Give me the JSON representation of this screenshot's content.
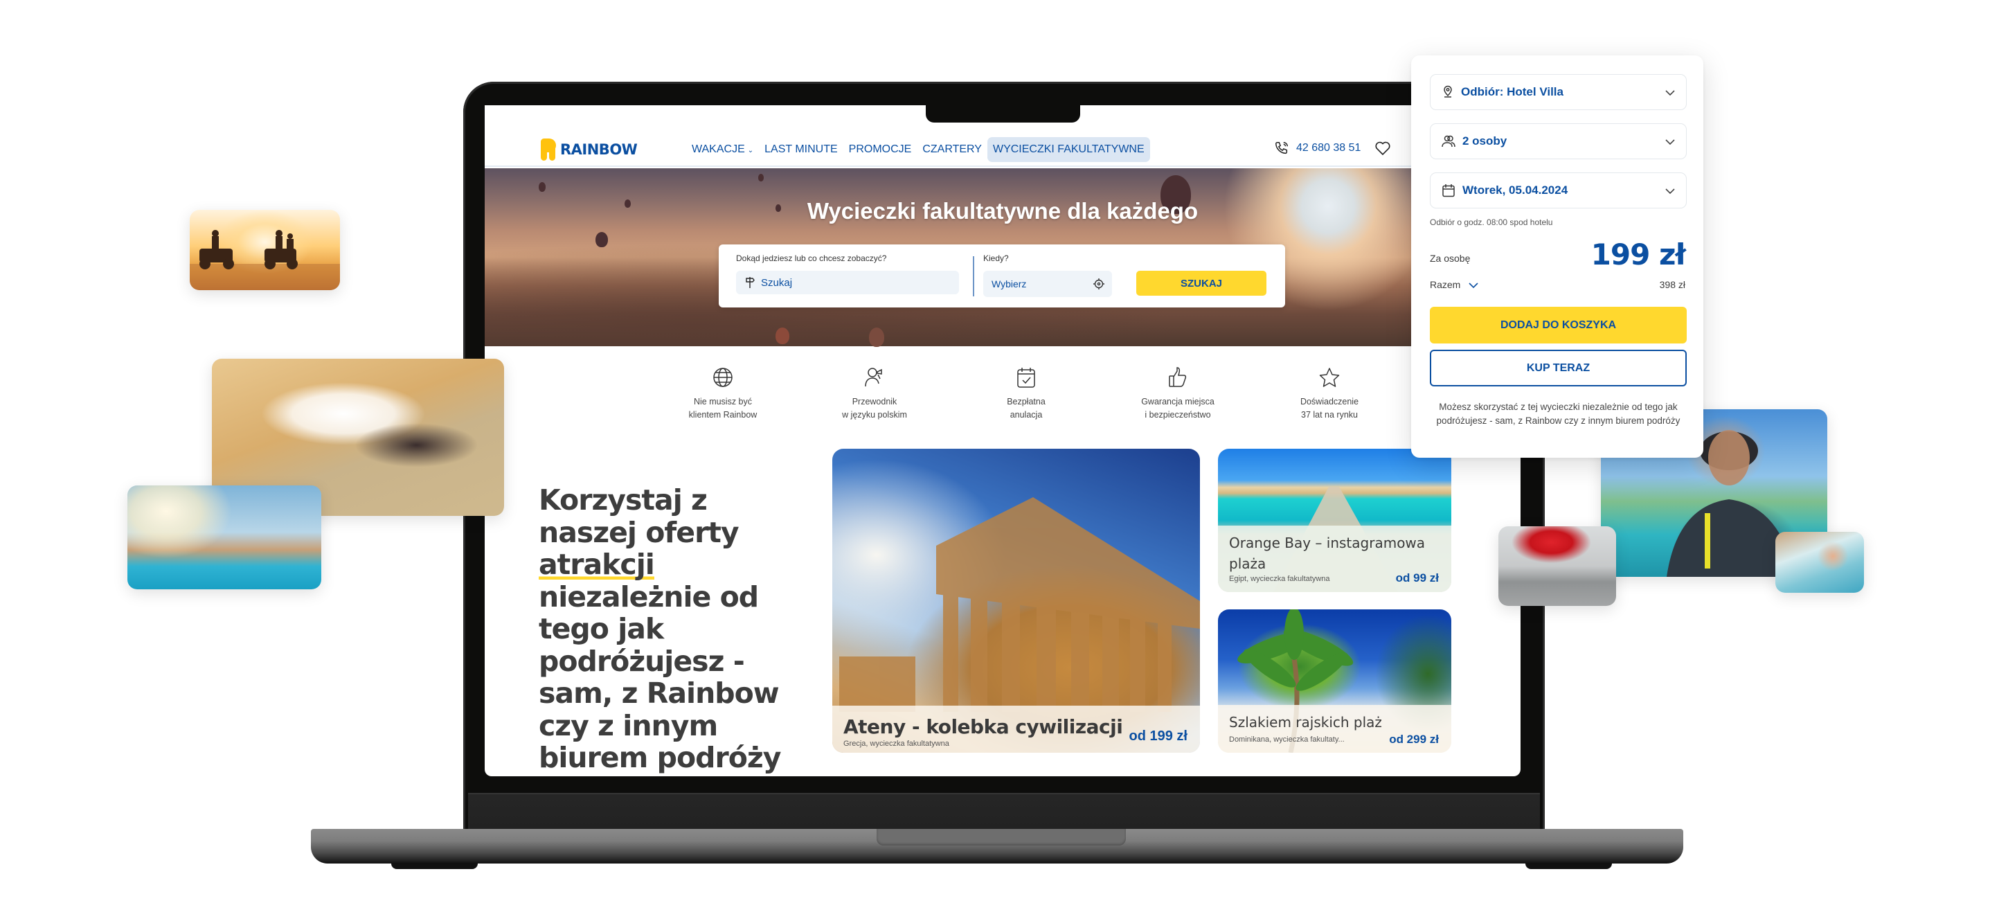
{
  "navbar": {
    "logo": "RAINBOW",
    "menu": [
      {
        "label": "WAKACJE",
        "has_dropdown": true,
        "active": false
      },
      {
        "label": "LAST MINUTE",
        "has_dropdown": false,
        "active": false
      },
      {
        "label": "PROMOCJE",
        "has_dropdown": false,
        "active": false
      },
      {
        "label": "CZARTERY",
        "has_dropdown": false,
        "active": false
      },
      {
        "label": "WYCIECZKI FAKULTATYWNE",
        "has_dropdown": false,
        "active": true
      }
    ],
    "phone": "42 680 38 51",
    "icons": [
      "phone-icon",
      "heart-icon"
    ]
  },
  "hero": {
    "title": "Wycieczki fakultatywne dla każdego",
    "search": {
      "where_label": "Dokąd jedziesz lub co chcesz zobaczyć?",
      "where_placeholder": "Szukaj",
      "when_label": "Kiedy?",
      "when_placeholder": "Wybierz",
      "button": "SZUKAJ"
    }
  },
  "features": [
    {
      "icon": "globe-icon",
      "line1": "Nie musisz być",
      "line2": "klientem Rainbow"
    },
    {
      "icon": "guide-icon",
      "line1": "Przewodnik",
      "line2": "w języku polskim"
    },
    {
      "icon": "calendar-check-icon",
      "line1": "Bezpłatna",
      "line2": "anulacja"
    },
    {
      "icon": "thumbs-up-icon",
      "line1": "Gwarancja miejsca",
      "line2": "i bezpieczeństwo"
    },
    {
      "icon": "star-icon",
      "line1": "Doświadczenie",
      "line2": "37 lat na rynku"
    }
  ],
  "promo": {
    "heading_before": "Korzystaj z naszej oferty",
    "heading_highlight": " atrakcji",
    "heading_after": " niezależnie od tego jak podróżujesz - sam, z Rainbow czy z innym biurem podróży"
  },
  "cards": [
    {
      "title": "Ateny - kolebka cywilizacji",
      "subtitle": "Grecja, wycieczka fakultatywna",
      "price": "od 199 zł"
    },
    {
      "title": "Orange Bay – instagramowa plaża",
      "subtitle": "Egipt, wycieczka fakultatywna",
      "price": "od 99 zł"
    },
    {
      "title": "Szlakiem rajskich plaż",
      "subtitle": "Dominikana, wycieczka fakultaty...",
      "price": "od 299 zł"
    }
  ],
  "booking_panel": {
    "pickup": "Odbiór: Hotel Villa",
    "persons": "2 osoby",
    "date": "Wtorek, 05.04.2024",
    "pickup_note": "Odbiór o godz. 08:00 spod hotelu",
    "per_person_label": "Za osobę",
    "per_person_price": "199 zł",
    "total_label": "Razem",
    "total_value": "398 zł",
    "add_to_cart": "DODAJ DO KOSZYKA",
    "buy_now": "KUP TERAZ",
    "note": "Możesz skorzystać z tej wycieczki niezależnie od tego jak podróżujesz - sam, z Rainbow czy z innym biurem podróży"
  },
  "decor_photos": [
    "quad-bikes-photo",
    "spa-massage-photo",
    "water-slide-photo",
    "scuba-diver-photo",
    "flamenco-dancer-photo",
    "kid-pool-photo"
  ],
  "colors": {
    "brand_blue": "#0b4fa1",
    "brand_yellow": "#ffd82e",
    "logo_yellow": "#ffc20e",
    "active_tab_bg": "#dbe6f3"
  }
}
